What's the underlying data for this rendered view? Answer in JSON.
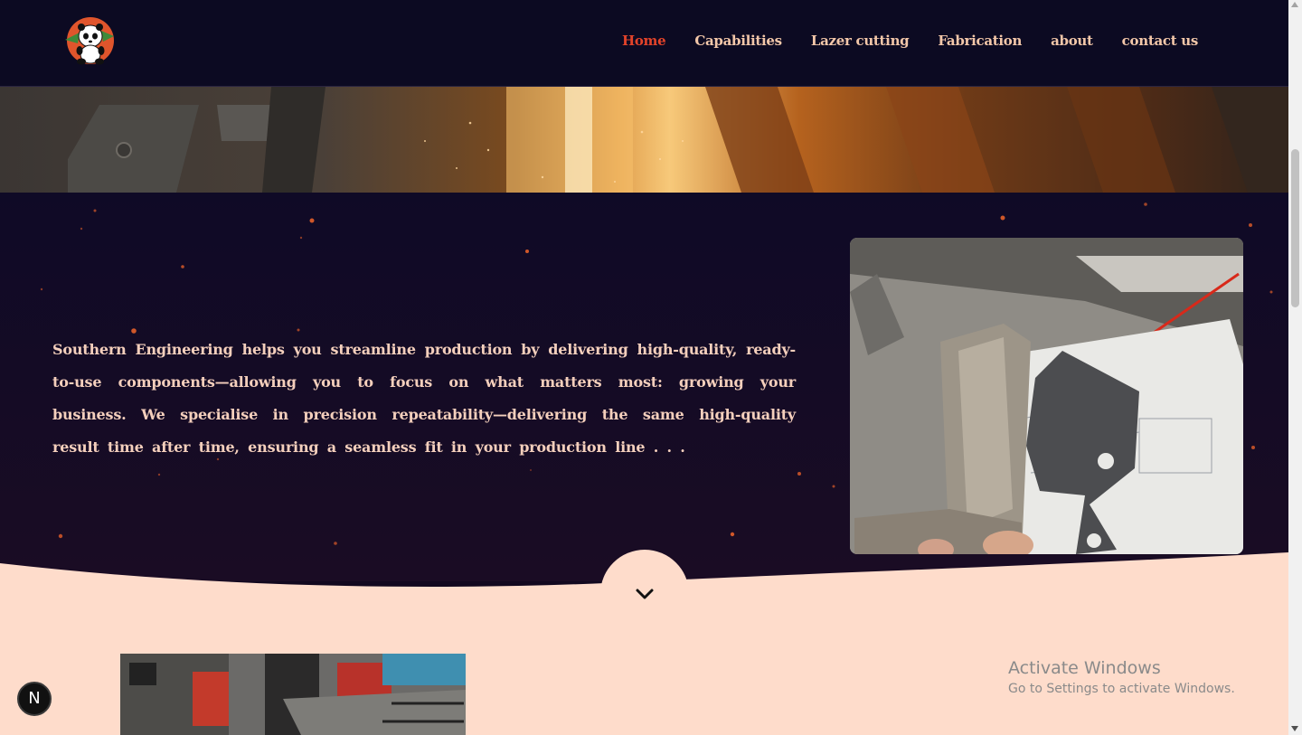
{
  "nav": {
    "links": [
      {
        "label": "Home",
        "active": true
      },
      {
        "label": "Capabilities",
        "active": false
      },
      {
        "label": "Lazer cutting",
        "active": false
      },
      {
        "label": "Fabrication",
        "active": false
      },
      {
        "label": "about",
        "active": false
      },
      {
        "label": "contact us",
        "active": false
      }
    ],
    "logo_icon": "panda-logo-icon"
  },
  "intro": {
    "text": "Southern Engineering helps you streamline production by delivering high-quality, ready-to-use components—allowing you to focus on what matters most: growing your business. We specialise in precision repeatability—delivering the same high-quality result time after time, ensuring a seamless fit in your production line . . ."
  },
  "scroll_button": {
    "icon": "chevron-down-icon"
  },
  "windows_notice": {
    "title": "Activate Windows",
    "subtitle": "Go to Settings to activate Windows."
  },
  "badge": {
    "label": "N"
  },
  "colors": {
    "nav_bg": "#0c0a22",
    "active_link": "#e2432a",
    "link": "#f3c7a9",
    "light_section": "#fedccb",
    "dark_section": "#12081f"
  }
}
